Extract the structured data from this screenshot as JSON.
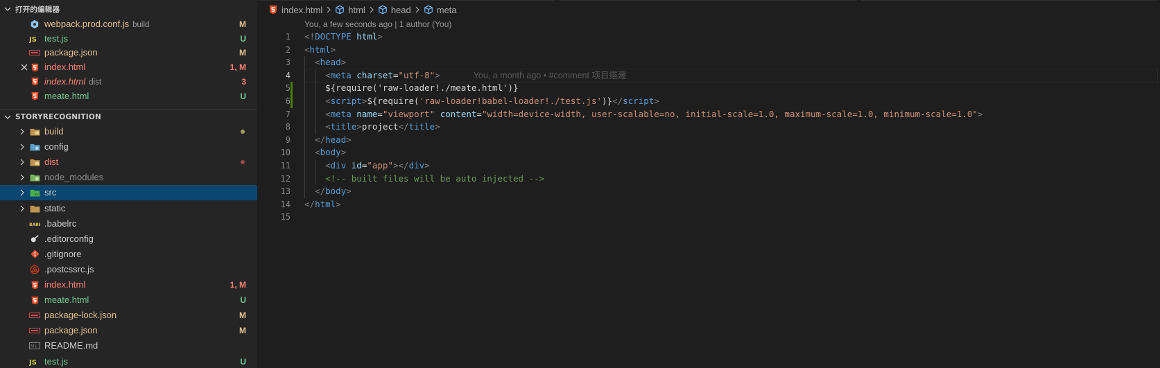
{
  "sidebar": {
    "open_editors": {
      "title": "打开的编辑器",
      "items": [
        {
          "name": "webpack.prod.conf.js",
          "desc": "build",
          "badge": "M",
          "icon": "js-gear-icon",
          "color": "#e2c08d",
          "italic": false
        },
        {
          "name": "test.js",
          "desc": "",
          "badge": "U",
          "icon": "js-icon",
          "color": "#73c991",
          "italic": false
        },
        {
          "name": "package.json",
          "desc": "",
          "badge": "M",
          "icon": "json-package-icon",
          "color": "#e2c08d",
          "italic": false
        },
        {
          "name": "index.html",
          "desc": "",
          "badge": "1, M",
          "icon": "html5-icon",
          "color": "#f88070",
          "italic": false
        },
        {
          "name": "index.html",
          "desc": "dist",
          "badge": "3",
          "icon": "html5-icon",
          "color": "#f88070",
          "italic": true
        },
        {
          "name": "meate.html",
          "desc": "",
          "badge": "U",
          "icon": "html5-icon",
          "color": "#73c991",
          "italic": false
        }
      ]
    },
    "project": {
      "title": "STORYRECOGNITION",
      "items": [
        {
          "name": "build",
          "type": "folder",
          "icon": "folder-build-icon",
          "color": "#e2c08d",
          "badge": "",
          "dot": "#a0a060"
        },
        {
          "name": "config",
          "type": "folder",
          "icon": "folder-config-icon",
          "color": "#cccccc",
          "badge": "",
          "dot": ""
        },
        {
          "name": "dist",
          "type": "folder",
          "icon": "folder-dist-icon",
          "color": "#f88070",
          "badge": "",
          "dot": "#9c4c4c"
        },
        {
          "name": "node_modules",
          "type": "folder",
          "icon": "folder-node-icon",
          "color": "#8c8c8c",
          "badge": "",
          "dot": ""
        },
        {
          "name": "src",
          "type": "folder",
          "icon": "folder-src-icon",
          "color": "#cccccc",
          "badge": "",
          "dot": "",
          "selected": true
        },
        {
          "name": "static",
          "type": "folder",
          "icon": "folder-icon",
          "color": "#cccccc",
          "badge": "",
          "dot": ""
        },
        {
          "name": ".babelrc",
          "type": "file",
          "icon": "babel-icon",
          "color": "#cccccc",
          "badge": "",
          "dot": ""
        },
        {
          "name": ".editorconfig",
          "type": "file",
          "icon": "editorconfig-icon",
          "color": "#cccccc",
          "badge": "",
          "dot": ""
        },
        {
          "name": ".gitignore",
          "type": "file",
          "icon": "git-icon",
          "color": "#cccccc",
          "badge": "",
          "dot": ""
        },
        {
          "name": ".postcssrc.js",
          "type": "file",
          "icon": "postcss-icon",
          "color": "#cccccc",
          "badge": "",
          "dot": ""
        },
        {
          "name": "index.html",
          "type": "file",
          "icon": "html5-icon",
          "color": "#f88070",
          "badge": "1, M",
          "dot": ""
        },
        {
          "name": "meate.html",
          "type": "file",
          "icon": "html5-icon",
          "color": "#73c991",
          "badge": "U",
          "dot": ""
        },
        {
          "name": "package-lock.json",
          "type": "file",
          "icon": "json-package-icon",
          "color": "#e2c08d",
          "badge": "M",
          "dot": ""
        },
        {
          "name": "package.json",
          "type": "file",
          "icon": "json-package-icon",
          "color": "#e2c08d",
          "badge": "M",
          "dot": ""
        },
        {
          "name": "README.md",
          "type": "file",
          "icon": "markdown-icon",
          "color": "#cccccc",
          "badge": "",
          "dot": ""
        },
        {
          "name": "test.js",
          "type": "file",
          "icon": "js-icon",
          "color": "#73c991",
          "badge": "U",
          "dot": ""
        }
      ]
    }
  },
  "editor": {
    "breadcrumb": [
      "index.html",
      "html",
      "head",
      "meta"
    ],
    "codelens": "You, a few seconds ago | 1 author (You)",
    "blame": "You, a month ago • #comment 项目搭建",
    "line_numbers": [
      "1",
      "2",
      "3",
      "4",
      "5",
      "6",
      "7",
      "8",
      "9",
      "10",
      "11",
      "12",
      "13",
      "14",
      "15"
    ],
    "lines": [
      [
        [
          "p",
          "<!"
        ],
        [
          "t",
          "DOCTYPE"
        ],
        [
          "w",
          " "
        ],
        [
          "a",
          "html"
        ],
        [
          "p",
          ">"
        ]
      ],
      [
        [
          "p",
          "<"
        ],
        [
          "t",
          "html"
        ],
        [
          "p",
          ">"
        ]
      ],
      [
        [
          "w",
          "  "
        ],
        [
          "p",
          "<"
        ],
        [
          "t",
          "head"
        ],
        [
          "p",
          ">"
        ]
      ],
      [
        [
          "w",
          "    "
        ],
        [
          "p",
          "<"
        ],
        [
          "t",
          "meta"
        ],
        [
          "w",
          " "
        ],
        [
          "a",
          "charset"
        ],
        [
          "w",
          "="
        ],
        [
          "s",
          "\"utf-8\""
        ],
        [
          "p",
          ">"
        ]
      ],
      [
        [
          "w",
          "    ${require('raw-loader!./meate.html')}"
        ]
      ],
      [
        [
          "w",
          "    "
        ],
        [
          "p",
          "<"
        ],
        [
          "t",
          "script"
        ],
        [
          "p",
          ">"
        ],
        [
          "w",
          "${require("
        ],
        [
          "s",
          "'raw-loader!babel-loader!./test.js'"
        ],
        [
          "w",
          ")}"
        ],
        [
          "p",
          "</"
        ],
        [
          "t",
          "script"
        ],
        [
          "p",
          ">"
        ]
      ],
      [
        [
          "w",
          "    "
        ],
        [
          "p",
          "<"
        ],
        [
          "t",
          "meta"
        ],
        [
          "w",
          " "
        ],
        [
          "a",
          "name"
        ],
        [
          "w",
          "="
        ],
        [
          "s",
          "\"viewport\""
        ],
        [
          "w",
          " "
        ],
        [
          "a",
          "content"
        ],
        [
          "w",
          "="
        ],
        [
          "s",
          "\"width=device-width, user-scalable=no, initial-scale=1.0, maximum-scale=1.0, minimum-scale=1.0\""
        ],
        [
          "p",
          ">"
        ]
      ],
      [
        [
          "w",
          "    "
        ],
        [
          "p",
          "<"
        ],
        [
          "t",
          "title"
        ],
        [
          "p",
          ">"
        ],
        [
          "w",
          "project"
        ],
        [
          "p",
          "</"
        ],
        [
          "t",
          "title"
        ],
        [
          "p",
          ">"
        ]
      ],
      [
        [
          "w",
          "  "
        ],
        [
          "p",
          "</"
        ],
        [
          "t",
          "head"
        ],
        [
          "p",
          ">"
        ]
      ],
      [
        [
          "w",
          "  "
        ],
        [
          "p",
          "<"
        ],
        [
          "t",
          "body"
        ],
        [
          "p",
          ">"
        ]
      ],
      [
        [
          "w",
          "    "
        ],
        [
          "p",
          "<"
        ],
        [
          "t",
          "div"
        ],
        [
          "w",
          " "
        ],
        [
          "a",
          "id"
        ],
        [
          "w",
          "="
        ],
        [
          "s",
          "\"app\""
        ],
        [
          "p",
          "></"
        ],
        [
          "t",
          "div"
        ],
        [
          "p",
          ">"
        ]
      ],
      [
        [
          "w",
          "    "
        ],
        [
          "c",
          "<!-- built files will be auto injected -->"
        ]
      ],
      [
        [
          "w",
          "  "
        ],
        [
          "p",
          "</"
        ],
        [
          "t",
          "body"
        ],
        [
          "p",
          ">"
        ]
      ],
      [
        [
          "p",
          "</"
        ],
        [
          "t",
          "html"
        ],
        [
          "p",
          ">"
        ]
      ],
      []
    ]
  }
}
